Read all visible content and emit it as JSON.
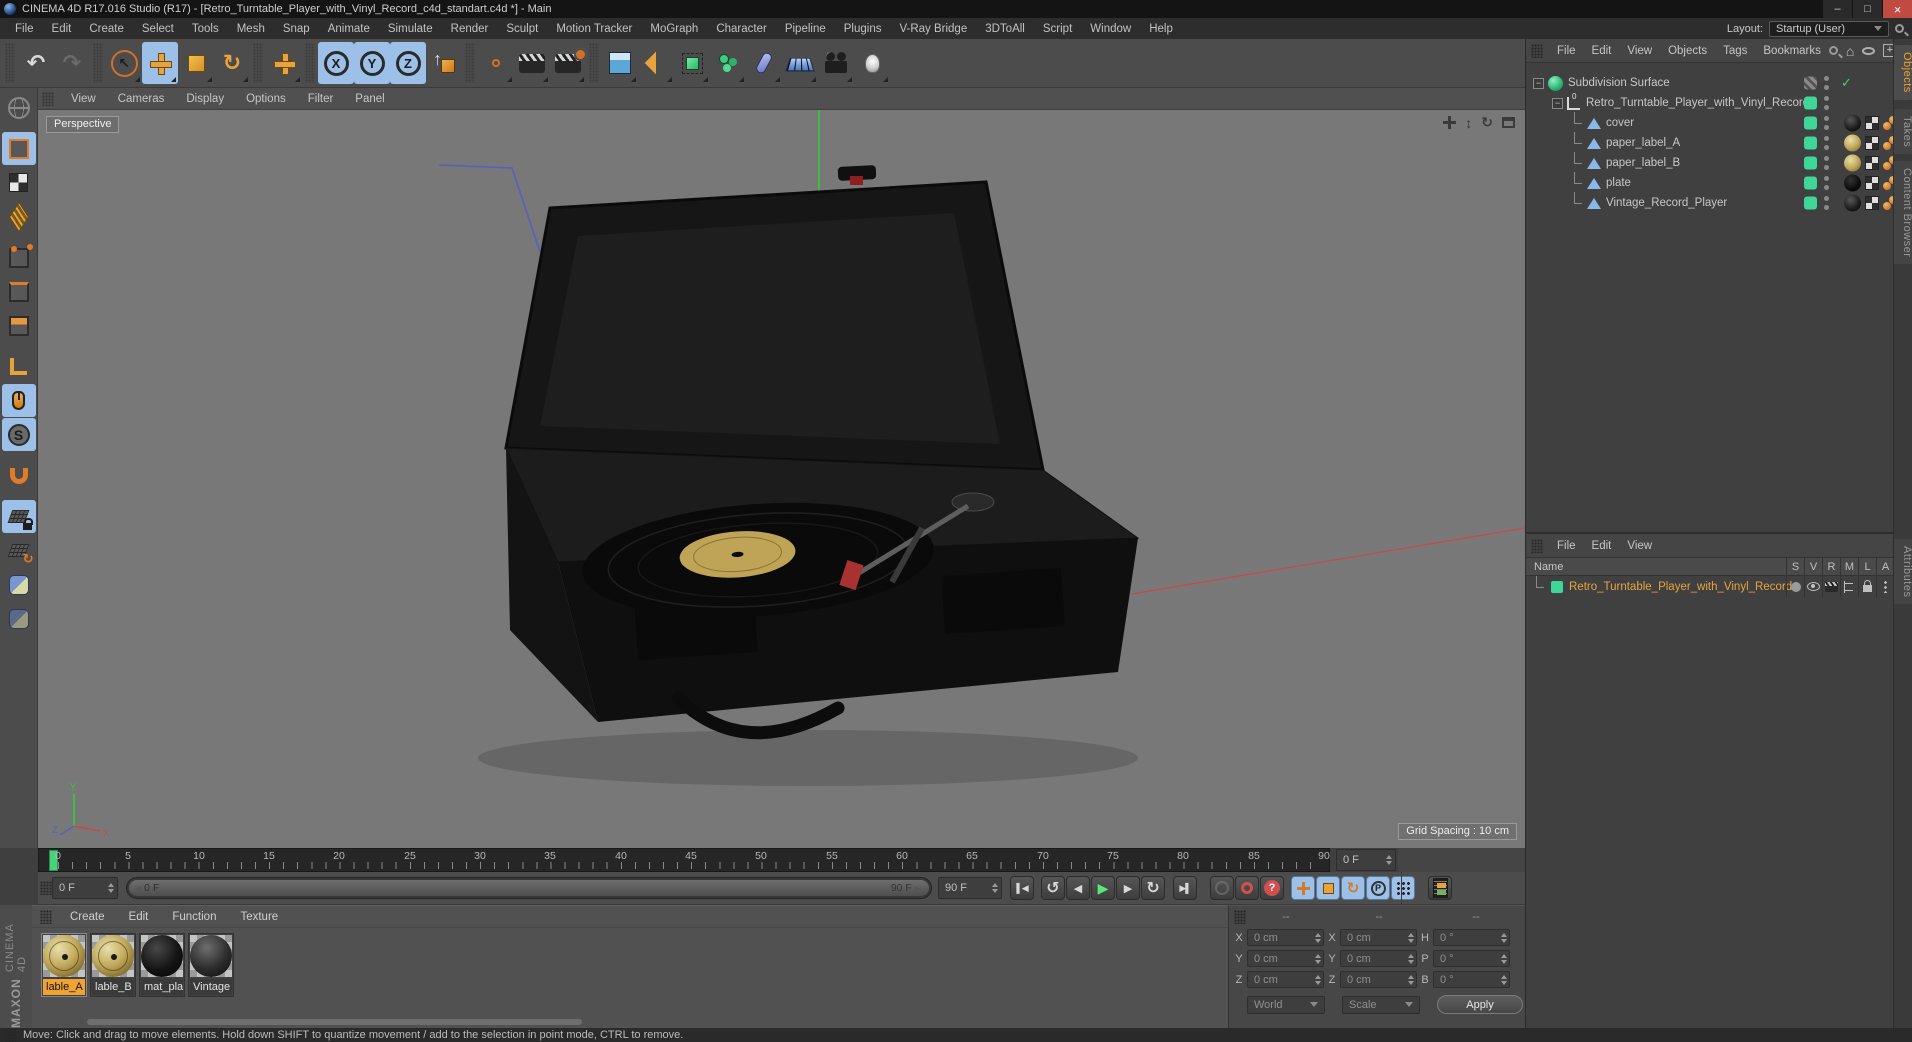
{
  "window": {
    "title": "CINEMA 4D R17.016 Studio (R17) - [Retro_Turntable_Player_with_Vinyl_Record_c4d_standart.c4d *] - Main"
  },
  "menubar": {
    "items": [
      "File",
      "Edit",
      "Create",
      "Select",
      "Tools",
      "Mesh",
      "Snap",
      "Animate",
      "Simulate",
      "Render",
      "Sculpt",
      "Motion Tracker",
      "MoGraph",
      "Character",
      "Pipeline",
      "Plugins",
      "V-Ray Bridge",
      "3DToAll",
      "Script",
      "Window",
      "Help"
    ],
    "layout_label": "Layout:",
    "layout_value": "Startup (User)"
  },
  "toolbar": {
    "axis_x": "X",
    "axis_y": "Y",
    "axis_z": "Z"
  },
  "palette": {
    "snap_letter": "S"
  },
  "viewport": {
    "menu": [
      "View",
      "Cameras",
      "Display",
      "Options",
      "Filter",
      "Panel"
    ],
    "camera_label": "Perspective",
    "grid_spacing_label": "Grid Spacing : 10 cm",
    "axis_x": "X",
    "axis_y": "Y",
    "axis_z": "Z"
  },
  "object_manager": {
    "menu": [
      "File",
      "Edit",
      "View",
      "Objects",
      "Tags",
      "Bookmarks"
    ],
    "tree": [
      {
        "label": "Subdivision Surface"
      },
      {
        "label": "Retro_Turntable_Player_with_Vinyl_Record",
        "zero": "0"
      },
      {
        "label": "cover"
      },
      {
        "label": "paper_label_A"
      },
      {
        "label": "paper_label_B"
      },
      {
        "label": "plate"
      },
      {
        "label": "Vintage_Record_Player"
      }
    ]
  },
  "right_tabs": {
    "objects": "Objects",
    "takes": "Takes",
    "content_browser": "Content Browser",
    "attributes": "Attributes"
  },
  "layer_manager": {
    "menu": [
      "File",
      "Edit",
      "View"
    ],
    "name_header": "Name",
    "columns": [
      "S",
      "V",
      "R",
      "M",
      "L",
      "A"
    ],
    "row": {
      "label": "Retro_Turntable_Player_with_Vinyl_Record"
    }
  },
  "timeline": {
    "ticks": [
      "0",
      "5",
      "10",
      "15",
      "20",
      "25",
      "30",
      "35",
      "40",
      "45",
      "50",
      "55",
      "60",
      "65",
      "70",
      "75",
      "80",
      "85",
      "90"
    ],
    "current_frame": "0 F",
    "slider_start": "0 F",
    "slider_end": "90 F",
    "end_frame": "90 F",
    "right_frame": "0 F"
  },
  "transport": {
    "parameter_letter": "P"
  },
  "materials": {
    "menu": [
      "Create",
      "Edit",
      "Function",
      "Texture"
    ],
    "items": [
      {
        "label": "lable_A"
      },
      {
        "label": "lable_B"
      },
      {
        "label": "mat_pla"
      },
      {
        "label": "Vintage"
      }
    ]
  },
  "coordinates": {
    "headers": [
      "--",
      "--",
      "--"
    ],
    "pos_labels": [
      "X",
      "Y",
      "Z"
    ],
    "pos_values": [
      "0 cm",
      "0 cm",
      "0 cm"
    ],
    "size_labels": [
      "X",
      "Y",
      "Z"
    ],
    "size_values": [
      "0 cm",
      "0 cm",
      "0 cm"
    ],
    "rot_labels": [
      "H",
      "P",
      "B"
    ],
    "rot_values": [
      "0 °",
      "0 °",
      "0 °"
    ],
    "world": "World",
    "scale": "Scale",
    "apply": "Apply"
  },
  "brand": {
    "maxon": "MAXON",
    "cinema": "CINEMA 4D"
  },
  "statusbar": {
    "text": "Move: Click and drag to move elements. Hold down SHIFT to quantize movement / add to the selection in point mode, CTRL to remove."
  },
  "colors": {
    "accent_orange": "#f0a232",
    "mint_green": "#3fd699",
    "active_blue": "#9cc0e8",
    "record_red": "#d05050",
    "axis_green": "#2fd42f",
    "axis_red": "#c84848",
    "axis_blue": "#5560c0",
    "gold_label": "#bfa457"
  }
}
